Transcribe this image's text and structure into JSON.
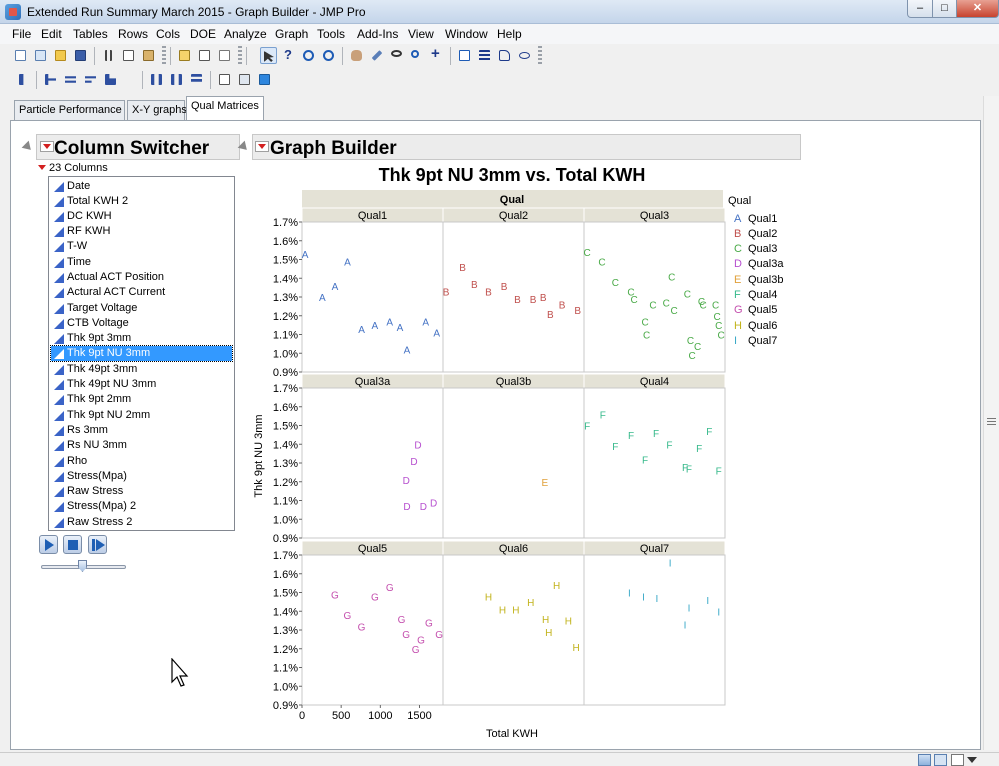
{
  "window": {
    "title": "Extended Run Summary March 2015 - Graph Builder - JMP Pro",
    "minimize": "–",
    "maximize": "□",
    "close": "✕"
  },
  "menu": [
    "File",
    "Edit",
    "Tables",
    "Rows",
    "Cols",
    "DOE",
    "Analyze",
    "Graph",
    "Tools",
    "Add-Ins",
    "View",
    "Window",
    "Help"
  ],
  "tabs": [
    {
      "label": "Particle Performance",
      "active": false
    },
    {
      "label": "X-Y graphs",
      "active": false
    },
    {
      "label": "Qual Matrices",
      "active": true
    }
  ],
  "column_switcher": {
    "title": "Column Switcher",
    "count_label": "23 Columns",
    "columns": [
      "Date",
      "Total KWH 2",
      "DC KWH",
      "RF KWH",
      "T-W",
      "Time",
      "Actual ACT Position",
      "Actural ACT Current",
      "Target Voltage",
      "CTB Voltage",
      "Thk 9pt 3mm",
      "Thk 9pt NU 3mm",
      "Thk 49pt 3mm",
      "Thk 49pt NU 3mm",
      "Thk 9pt 2mm",
      "Thk 9pt NU 2mm",
      "Rs 3mm",
      "Rs NU 3mm",
      "Rho",
      "Stress(Mpa)",
      "Raw Stress",
      "Stress(Mpa) 2",
      "Raw Stress 2"
    ],
    "selected": "Thk 9pt NU 3mm"
  },
  "graph_builder": {
    "title": "Graph Builder"
  },
  "chart_data": {
    "type": "scatter",
    "title": "Thk 9pt NU 3mm vs. Total KWH",
    "xlabel": "Total KWH",
    "ylabel": "Thk 9pt NU 3mm",
    "group_title": "Qual",
    "legend_title": "Qual",
    "legend_position": "right",
    "xlim": [
      0,
      1800
    ],
    "ylim": [
      0.009,
      0.017
    ],
    "x_ticks": [
      "0",
      "500",
      "1000",
      "1500"
    ],
    "x_tick_values": [
      0,
      500,
      1000,
      1500
    ],
    "y_ticks": [
      "0.9%",
      "1.0%",
      "1.1%",
      "1.2%",
      "1.3%",
      "1.4%",
      "1.5%",
      "1.6%",
      "1.7%"
    ],
    "y_tick_values": [
      0.009,
      0.01,
      0.011,
      0.012,
      0.013,
      0.014,
      0.015,
      0.016,
      0.017
    ],
    "panel_grid": [
      [
        "Qual1",
        "Qual2",
        "Qual3"
      ],
      [
        "Qual3a",
        "Qual3b",
        "Qual4"
      ],
      [
        "Qual5",
        "Qual6",
        "Qual7"
      ]
    ],
    "series": [
      {
        "name": "Qual1",
        "marker": "A",
        "color": "#4472c4",
        "x": [
          40,
          260,
          420,
          580,
          760,
          930,
          1120,
          1250,
          1340,
          1580,
          1720
        ],
        "y": [
          0.0153,
          0.013,
          0.0136,
          0.0149,
          0.0113,
          0.0115,
          0.0117,
          0.0114,
          0.0102,
          0.0117,
          0.0111
        ]
      },
      {
        "name": "Qual2",
        "marker": "B",
        "color": "#c0504d",
        "x": [
          40,
          250,
          400,
          580,
          780,
          950,
          1150,
          1280,
          1370,
          1520,
          1720
        ],
        "y": [
          0.0133,
          0.0146,
          0.0137,
          0.0133,
          0.0136,
          0.0129,
          0.0129,
          0.013,
          0.0121,
          0.0126,
          0.0123
        ]
      },
      {
        "name": "Qual3",
        "marker": "C",
        "color": "#4aaa48",
        "x": [
          40,
          230,
          400,
          600,
          640,
          780,
          800,
          880,
          1050,
          1120,
          1150,
          1320,
          1360,
          1380,
          1450,
          1500,
          1520,
          1680,
          1700,
          1720,
          1750
        ],
        "y": [
          0.0154,
          0.0149,
          0.0138,
          0.0133,
          0.0129,
          0.0117,
          0.011,
          0.0126,
          0.0127,
          0.0141,
          0.0123,
          0.0132,
          0.0107,
          0.0099,
          0.0104,
          0.0128,
          0.0126,
          0.0126,
          0.012,
          0.0115,
          0.011
        ]
      },
      {
        "name": "Qual3a",
        "marker": "D",
        "color": "#b64fcf",
        "x": [
          1340,
          1330,
          1430,
          1480,
          1550,
          1680
        ],
        "y": [
          0.0107,
          0.0121,
          0.0131,
          0.014,
          0.0107,
          0.0109
        ]
      },
      {
        "name": "Qual3b",
        "marker": "E",
        "color": "#e0a03a",
        "x": [
          1300
        ],
        "y": [
          0.012
        ]
      },
      {
        "name": "Qual4",
        "marker": "F",
        "color": "#36b98b",
        "x": [
          40,
          240,
          400,
          600,
          780,
          920,
          1090,
          1290,
          1340,
          1470,
          1600,
          1720
        ],
        "y": [
          0.015,
          0.0156,
          0.0139,
          0.0145,
          0.0132,
          0.0146,
          0.014,
          0.0128,
          0.0127,
          0.0138,
          0.0147,
          0.0126
        ]
      },
      {
        "name": "Qual5",
        "marker": "G",
        "color": "#c44fae",
        "x": [
          420,
          580,
          760,
          930,
          1120,
          1270,
          1330,
          1450,
          1520,
          1620,
          1750
        ],
        "y": [
          0.0149,
          0.0138,
          0.0132,
          0.0148,
          0.0153,
          0.0136,
          0.0128,
          0.012,
          0.0125,
          0.0134,
          0.0128
        ]
      },
      {
        "name": "Qual6",
        "marker": "H",
        "color": "#c2b31b",
        "x": [
          580,
          760,
          930,
          1120,
          1310,
          1350,
          1450,
          1600,
          1700
        ],
        "y": [
          0.0148,
          0.0141,
          0.0141,
          0.0145,
          0.0136,
          0.0129,
          0.0154,
          0.0135,
          0.0121
        ]
      },
      {
        "name": "Qual7",
        "marker": "I",
        "color": "#3aa9c8",
        "x": [
          580,
          760,
          930,
          1100,
          1290,
          1340,
          1580,
          1720
        ],
        "y": [
          0.015,
          0.0148,
          0.0147,
          0.0166,
          0.0133,
          0.0142,
          0.0146,
          0.014
        ]
      }
    ]
  }
}
